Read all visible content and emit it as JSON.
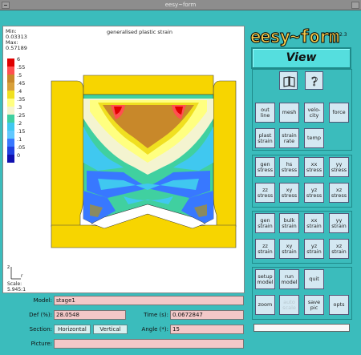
{
  "window": {
    "title": "eesy~form"
  },
  "plot": {
    "min_label": "Min:",
    "min_value": "0.03313",
    "max_label": "Max:",
    "max_value": "0.57189",
    "title": "generalised plastic strain",
    "legend": [
      "6",
      ".55",
      ".5",
      ".45",
      ".4",
      ".35",
      ".3",
      ".25",
      ".2",
      ".15",
      ".1",
      ".05",
      "0"
    ],
    "legend_colors": [
      "#e00000",
      "#ff5050",
      "#c8882a",
      "#d8a03a",
      "#f0e020",
      "#ffff80",
      "#f4f4d0",
      "#40d0a0",
      "#40c8f0",
      "#60c8ff",
      "#3878ff",
      "#2040e0",
      "#1010b0"
    ],
    "axis_z": "z",
    "axis_r": "r",
    "scale_label": "Scale:",
    "scale_value": "5.945:1"
  },
  "form": {
    "model_label": "Model:",
    "model_value": "stage1",
    "def_label": "Def (%):",
    "def_value": "28.0548",
    "time_label": "Time (s):",
    "time_value": "0.0672847",
    "section_label": "Section:",
    "horizontal_btn": "Horizontal",
    "vertical_btn": "Vertical",
    "angle_label": "Angle (*):",
    "angle_value": "15",
    "picture_label": "Picture:",
    "picture_value": ""
  },
  "right": {
    "logo": "eesy~form",
    "version": "2.3",
    "view_label": "View",
    "view_buttons": [
      {
        "l1": "out",
        "l2": "line"
      },
      {
        "l1": "mesh",
        "l2": ""
      },
      {
        "l1": "velo-",
        "l2": "city"
      },
      {
        "l1": "force",
        "l2": ""
      },
      {
        "l1": "plast",
        "l2": "strain"
      },
      {
        "l1": "strain",
        "l2": "rate"
      },
      {
        "l1": "temp",
        "l2": ""
      }
    ],
    "stress_buttons": [
      {
        "l1": "gen",
        "l2": "stress"
      },
      {
        "l1": "hs",
        "l2": "stress"
      },
      {
        "l1": "xx",
        "l2": "stress"
      },
      {
        "l1": "yy",
        "l2": "stress"
      },
      {
        "l1": "zz",
        "l2": "stress"
      },
      {
        "l1": "xy",
        "l2": "stress"
      },
      {
        "l1": "yz",
        "l2": "stress"
      },
      {
        "l1": "xz",
        "l2": "stress"
      }
    ],
    "strain_buttons": [
      {
        "l1": "gen",
        "l2": "strain"
      },
      {
        "l1": "bulk",
        "l2": "strain"
      },
      {
        "l1": "xx",
        "l2": "strain"
      },
      {
        "l1": "yy",
        "l2": "strain"
      },
      {
        "l1": "zz",
        "l2": "strain"
      },
      {
        "l1": "xy",
        "l2": "strain"
      },
      {
        "l1": "yz",
        "l2": "strain"
      },
      {
        "l1": "xz",
        "l2": "strain"
      }
    ],
    "control_buttons": [
      {
        "l1": "setup",
        "l2": "model"
      },
      {
        "l1": "run",
        "l2": "model"
      },
      {
        "l1": "quit",
        "l2": ""
      },
      {
        "l1": "zoom",
        "l2": ""
      },
      {
        "l1": "auto",
        "l2": "scale"
      },
      {
        "l1": "save",
        "l2": "pic"
      },
      {
        "l1": "opts",
        "l2": ""
      }
    ],
    "message": ""
  }
}
